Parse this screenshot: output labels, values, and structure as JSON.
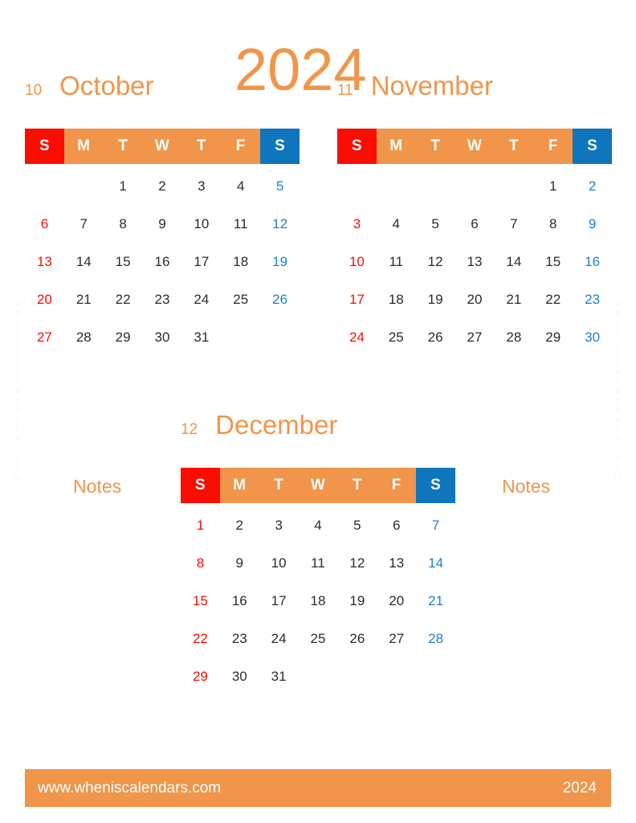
{
  "title": {
    "year": "2024"
  },
  "watermark": {
    "text": "wheniscalendars.com"
  },
  "weekdays": [
    "S",
    "M",
    "T",
    "W",
    "T",
    "F",
    "S"
  ],
  "months": [
    {
      "number": "10",
      "name": "October",
      "weeks": [
        [
          "",
          "",
          "1",
          "2",
          "3",
          "4",
          "5"
        ],
        [
          "6",
          "7",
          "8",
          "9",
          "10",
          "11",
          "12"
        ],
        [
          "13",
          "14",
          "15",
          "16",
          "17",
          "18",
          "19"
        ],
        [
          "20",
          "21",
          "22",
          "23",
          "24",
          "25",
          "26"
        ],
        [
          "27",
          "28",
          "29",
          "30",
          "31",
          "",
          ""
        ]
      ]
    },
    {
      "number": "11",
      "name": "November",
      "weeks": [
        [
          "",
          "",
          "",
          "",
          "",
          "1",
          "2"
        ],
        [
          "3",
          "4",
          "5",
          "6",
          "7",
          "8",
          "9"
        ],
        [
          "10",
          "11",
          "12",
          "13",
          "14",
          "15",
          "16"
        ],
        [
          "17",
          "18",
          "19",
          "20",
          "21",
          "22",
          "23"
        ],
        [
          "24",
          "25",
          "26",
          "27",
          "28",
          "29",
          "30"
        ]
      ]
    },
    {
      "number": "12",
      "name": "December",
      "weeks": [
        [
          "1",
          "2",
          "3",
          "4",
          "5",
          "6",
          "7"
        ],
        [
          "8",
          "9",
          "10",
          "11",
          "12",
          "13",
          "14"
        ],
        [
          "15",
          "16",
          "17",
          "18",
          "19",
          "20",
          "21"
        ],
        [
          "22",
          "23",
          "24",
          "25",
          "26",
          "27",
          "28"
        ],
        [
          "29",
          "30",
          "31",
          "",
          "",
          "",
          ""
        ]
      ]
    }
  ],
  "notes": {
    "left_label": "Notes",
    "right_label": "Notes"
  },
  "footer": {
    "url": "www.wheniscalendars.com",
    "year": "2024"
  },
  "colors": {
    "orange": "#f0954a",
    "sunday_red": "#fb0d02",
    "saturday_blue": "#0f75bd",
    "saturday_text_blue": "#1a7fd4",
    "day_text": "#2b2b2b",
    "white": "#ffffff"
  }
}
